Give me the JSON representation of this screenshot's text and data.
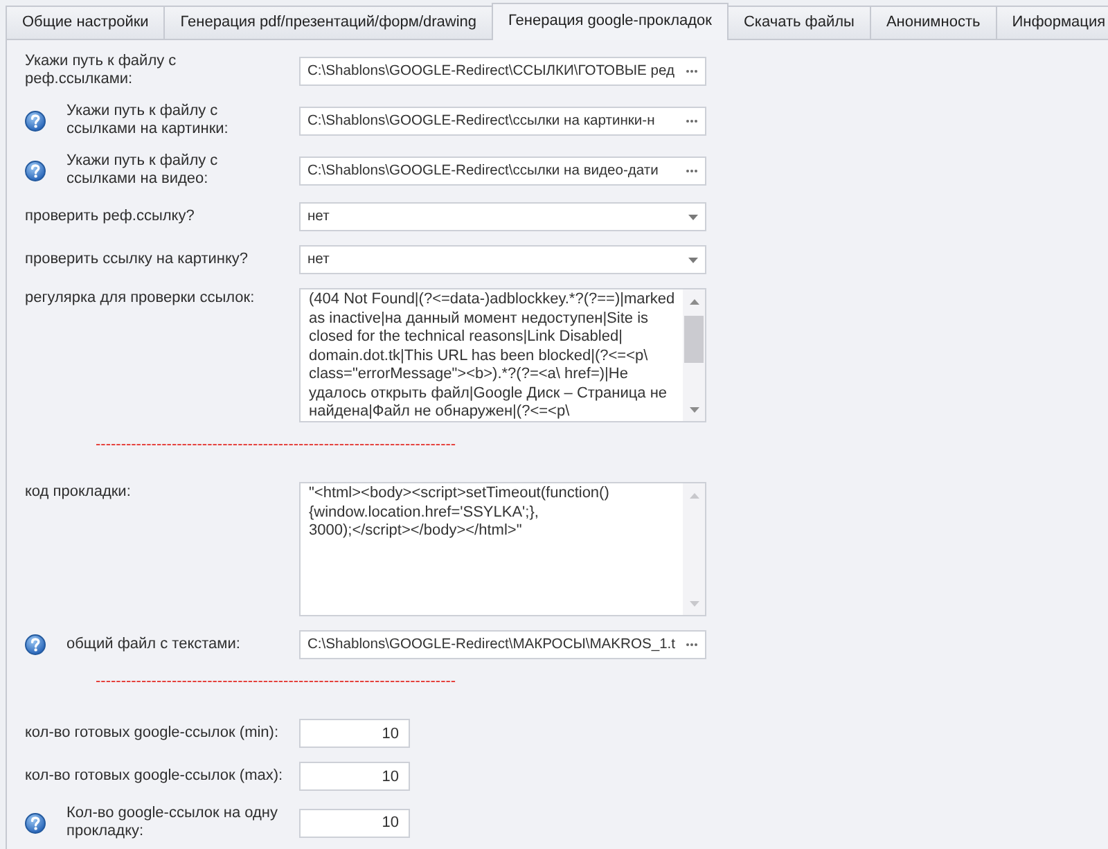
{
  "tabs": [
    {
      "label": "Общие настройки",
      "selected": false
    },
    {
      "label": "Генерация pdf/презентаций/форм/drawing",
      "selected": false
    },
    {
      "label": "Генерация google-прокладок",
      "selected": true
    },
    {
      "label": "Скачать файлы",
      "selected": false
    },
    {
      "label": "Анонимность",
      "selected": false
    },
    {
      "label": "Информация",
      "selected": false
    }
  ],
  "form": [
    {
      "kind": "file",
      "label": "Укажи путь к файлу с\nреф.ссылками:",
      "help": false,
      "value": "C:\\Shablons\\GOOGLE-Redirect\\ССЫЛКИ\\ГОТОВЫЕ ред"
    },
    {
      "kind": "file",
      "label": "Укажи путь к файлу с\nссылками на картинки:",
      "help": true,
      "value": "C:\\Shablons\\GOOGLE-Redirect\\ссылки на картинки-н"
    },
    {
      "kind": "file",
      "label": "Укажи путь к файлу с\nссылками на видео:",
      "help": true,
      "value": "C:\\Shablons\\GOOGLE-Redirect\\ссылки на видео-дати"
    },
    {
      "kind": "select",
      "label": "проверить реф.ссылку?",
      "help": false,
      "value": "нет"
    },
    {
      "kind": "select",
      "label": "проверить ссылку на картинку?",
      "help": false,
      "value": "нет"
    },
    {
      "kind": "textarea",
      "label": "регулярка для проверки ссылок:",
      "help": false,
      "scrollable": true,
      "value": "(404 Not Found|(?<=data-)adblockkey.*?(?==)|marked\nas inactive|на данный момент недоступен|Site is\nclosed for the technical reasons|Link Disabled|\ndomain.dot.tk|This URL has been blocked|(?<=<p\\\nclass=\"errorMessage\"><b>).*?(?=<a\\ href=)|Не\nудалось открыть файл|Google Диск – Страница не\nнайдена|Файл не обнаружен|(?<=<p\\"
    },
    {
      "kind": "separator",
      "text": "-----------------------------------------------------------------------"
    },
    {
      "kind": "textarea",
      "label": "код прокладки:",
      "help": false,
      "scrollable": false,
      "value": "\"<html><body><script>setTimeout(function()\n{window.location.href='SSYLKA';},\n3000);</script></body></html>\""
    },
    {
      "kind": "file",
      "label": "общий файл с текстами:",
      "help": true,
      "value": "C:\\Shablons\\GOOGLE-Redirect\\МАКРОСЫ\\MAKROS_1.t"
    },
    {
      "kind": "separator",
      "text": "-----------------------------------------------------------------------"
    },
    {
      "kind": "number",
      "label": "кол-во готовых google-ссылок (min):",
      "help": false,
      "value": "10"
    },
    {
      "kind": "number",
      "label": "кол-во готовых google-ссылок (max):",
      "help": false,
      "value": "10"
    },
    {
      "kind": "number",
      "label": "Кол-во google-ссылок на одну\nпрокладку:",
      "help": true,
      "value": "10"
    }
  ]
}
